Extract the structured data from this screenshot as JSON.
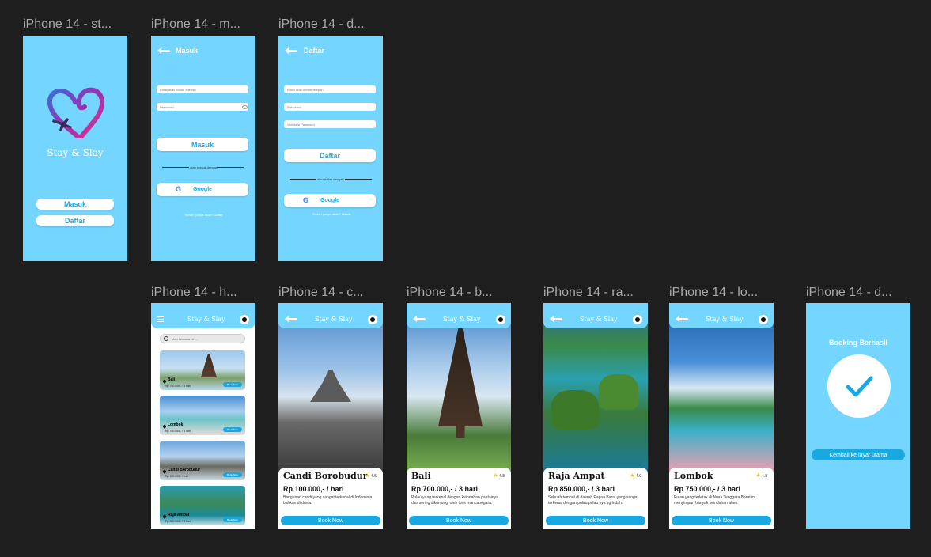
{
  "frames": [
    {
      "label": "iPhone 14 - st..."
    },
    {
      "label": "iPhone 14 - m..."
    },
    {
      "label": "iPhone 14 - d..."
    },
    {
      "label": "iPhone 14 - h..."
    },
    {
      "label": "iPhone 14 - c..."
    },
    {
      "label": "iPhone 14 - b..."
    },
    {
      "label": "iPhone 14 - ra..."
    },
    {
      "label": "iPhone 14 - lo..."
    },
    {
      "label": "iPhone 14 - d..."
    }
  ],
  "splash": {
    "brand": "Stay & Slay",
    "login_button": "Masuk",
    "register_button": "Daftar"
  },
  "login": {
    "title": "Masuk",
    "email_placeholder": "Email atau nomor telepon",
    "password_placeholder": "Password",
    "submit_button": "Masuk",
    "divider_text": "atau masuk dengan",
    "google_button": "Google",
    "footer_text": "Belum punya akun? Daftar"
  },
  "register": {
    "title": "Daftar",
    "email_placeholder": "Email atau nomor telepon",
    "password_placeholder": "Password",
    "confirm_placeholder": "Verifikasi Password",
    "submit_button": "Daftar",
    "divider_text": "atau daftar dengan",
    "google_button": "Google",
    "footer_text": "Sudah punya akun? Masuk"
  },
  "home": {
    "brand": "Stay & Slay",
    "search_placeholder": "Mau kemana nih...",
    "cards": [
      {
        "name": "Bali",
        "price": "Rp 750.000,- / 3 hari",
        "button": "Book Now"
      },
      {
        "name": "Lombok",
        "price": "Rp 750.000,- / 3 hari",
        "button": "Book Now"
      },
      {
        "name": "Candi Borobudur",
        "price": "Rp 100.000,- / hari",
        "button": "Book Now"
      },
      {
        "name": "Raja Ampat",
        "price": "Rp 850.000,- / 3 hari",
        "button": "Book Now"
      }
    ]
  },
  "details": [
    {
      "brand": "Stay & Slay",
      "name": "Candi Borobudur",
      "rating": "4.5",
      "price": "Rp 100.000,- / hari",
      "description": "Bangunan candi yang sangat terkenal di Indonesia bahkan di dunia.",
      "button": "Book Now"
    },
    {
      "brand": "Stay & Slay",
      "name": "Bali",
      "rating": "4.8",
      "price": "Rp 700.000,- / 3 hari",
      "description": "Pulau yang terkenal dengan keindahan pantainya dan sering dikunjungi oleh turis mancanegara.",
      "button": "Book Now"
    },
    {
      "brand": "Stay & Slay",
      "name": "Raja Ampat",
      "rating": "4.9",
      "price": "Rp 850.000,- / 3 hari",
      "description": "Sebuah tempat di daerah Papua Barat yang sangat terkenal dengan pulau pulau nya yg indah.",
      "button": "Book Now"
    },
    {
      "brand": "Stay & Slay",
      "name": "Lombok",
      "rating": "4.8",
      "price": "Rp 750.000,- / 3 hari",
      "description": "Pulau yang terletak di Nusa Tenggara Barat ini menyimpan banyak keindahan alam.",
      "button": "Book Now"
    }
  ],
  "done": {
    "title": "Booking Berhasil",
    "button": "Kembali ke layar utama"
  },
  "colors": {
    "canvas": "#1e1e1e",
    "frame": "#74d6ff",
    "accent": "#1aa8e0",
    "label": "#a8a8a8"
  }
}
